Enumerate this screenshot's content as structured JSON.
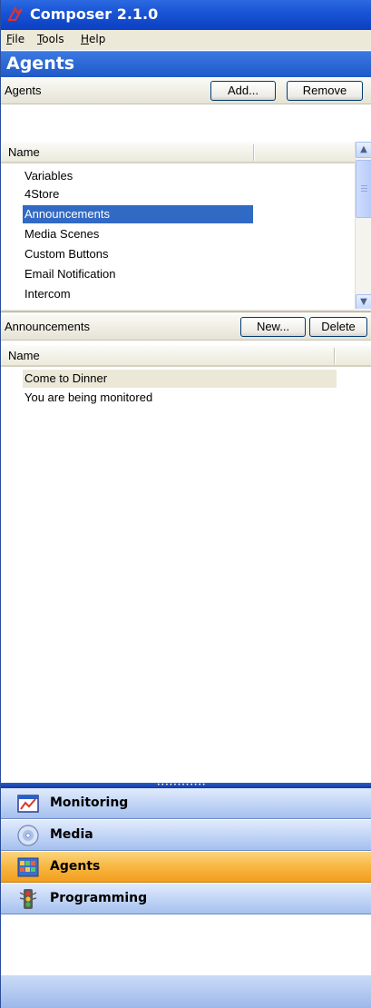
{
  "window": {
    "title": "Composer 2.1.0"
  },
  "menu": [
    {
      "label": "File",
      "mnemonic": "F",
      "rest": "ile"
    },
    {
      "label": "Tools",
      "mnemonic": "T",
      "rest": "ools"
    },
    {
      "label": "Help",
      "mnemonic": "H",
      "rest": "elp"
    }
  ],
  "panel": {
    "title": "Agents"
  },
  "agents_section": {
    "label": "Agents",
    "add_label": "Add...",
    "remove_label": "Remove",
    "column": "Name",
    "items": [
      "Variables",
      "4Store",
      "Announcements",
      "Media Scenes",
      "Custom Buttons",
      "Email Notification",
      "Intercom"
    ],
    "selected": "Announcements"
  },
  "announcements_section": {
    "label": "Announcements",
    "new_label": "New...",
    "delete_label": "Delete",
    "column": "Name",
    "items": [
      "Come to Dinner",
      "You are being monitored"
    ]
  },
  "nav": {
    "items": [
      {
        "label": "Monitoring",
        "icon": "monitoring-icon",
        "active": false
      },
      {
        "label": "Media",
        "icon": "media-disc-icon",
        "active": false
      },
      {
        "label": "Agents",
        "icon": "agents-icon",
        "active": true
      },
      {
        "label": "Programming",
        "icon": "traffic-light-icon",
        "active": false
      }
    ]
  },
  "colors": {
    "selection": "#316ac5",
    "active_nav": "#f8b641",
    "title_blue": "#1a55d6"
  }
}
